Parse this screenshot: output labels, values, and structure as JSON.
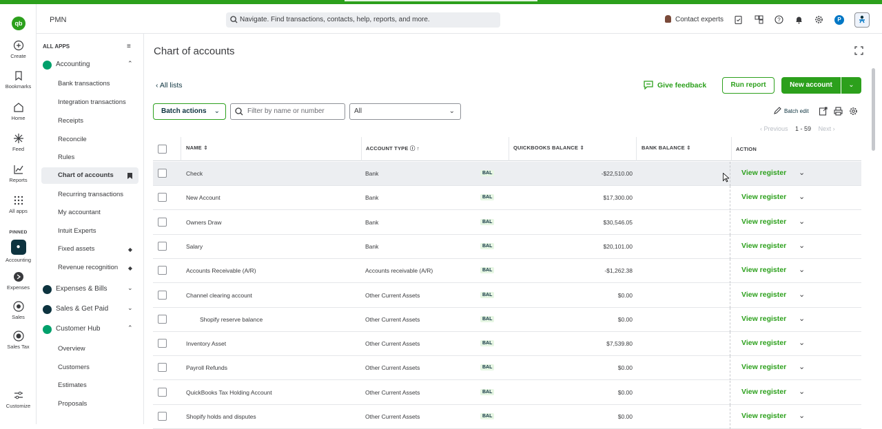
{
  "company": "PMN",
  "search": {
    "placeholder": "Navigate. Find transactions, contacts, help, reports, and more."
  },
  "header": {
    "contact_experts": "Contact experts",
    "avatar_letter": "P"
  },
  "rail": {
    "create": "Create",
    "bookmarks": "Bookmarks",
    "home": "Home",
    "feed": "Feed",
    "reports": "Reports",
    "all_apps": "All apps",
    "pinned": "PINNED",
    "accounting": "Accounting",
    "expenses": "Expenses",
    "sales": "Sales",
    "sales_tax": "Sales Tax",
    "customize": "Customize"
  },
  "sidebar": {
    "all_apps": "ALL APPS",
    "accounting": "Accounting",
    "accounting_items": [
      "Bank transactions",
      "Integration transactions",
      "Receipts",
      "Reconcile",
      "Rules",
      "Chart of accounts",
      "Recurring transactions",
      "My accountant",
      "Intuit Experts",
      "Fixed assets",
      "Revenue recognition"
    ],
    "expenses": "Expenses & Bills",
    "sales": "Sales & Get Paid",
    "customer_hub": "Customer Hub",
    "customer_items": [
      "Overview",
      "Customers",
      "Estimates",
      "Proposals"
    ]
  },
  "main": {
    "title": "Chart of accounts",
    "all_lists": "All lists",
    "give_feedback": "Give feedback",
    "run_report": "Run report",
    "new_account": "New account",
    "batch_actions": "Batch actions",
    "filter_placeholder": "Filter by name or number",
    "type_select": "All",
    "batch_edit": "Batch edit",
    "pager": {
      "previous": "Previous",
      "count": "1 - 59",
      "next": "Next"
    }
  },
  "table": {
    "headers": {
      "name": "NAME",
      "type": "ACCOUNT TYPE",
      "qb_balance": "QUICKBOOKS BALANCE",
      "bank_balance": "BANK BALANCE",
      "action": "ACTION"
    },
    "rows": [
      {
        "name": "Check",
        "type": "Bank",
        "badge": "BAL",
        "qb": "-$22,510.00",
        "bank": "",
        "action": "View register"
      },
      {
        "name": "New Account",
        "type": "Bank",
        "badge": "BAL",
        "qb": "$17,300.00",
        "bank": "",
        "action": "View register"
      },
      {
        "name": "Owners Draw",
        "type": "Bank",
        "badge": "BAL",
        "qb": "$30,546.05",
        "bank": "",
        "action": "View register"
      },
      {
        "name": "Salary",
        "type": "Bank",
        "badge": "BAL",
        "qb": "$20,101.00",
        "bank": "",
        "action": "View register"
      },
      {
        "name": "Accounts Receivable (A/R)",
        "type": "Accounts receivable (A/R)",
        "badge": "BAL",
        "qb": "-$1,262.38",
        "bank": "",
        "action": "View register"
      },
      {
        "name": "Channel clearing account",
        "type": "Other Current Assets",
        "badge": "BAL",
        "qb": "$0.00",
        "bank": "",
        "action": "View register"
      },
      {
        "name": "Shopify reserve balance",
        "type": "Other Current Assets",
        "badge": "BAL",
        "qb": "$0.00",
        "bank": "",
        "action": "View register",
        "sub": true
      },
      {
        "name": "Inventory Asset",
        "type": "Other Current Assets",
        "badge": "BAL",
        "qb": "$7,539.80",
        "bank": "",
        "action": "View register"
      },
      {
        "name": "Payroll Refunds",
        "type": "Other Current Assets",
        "badge": "BAL",
        "qb": "$0.00",
        "bank": "",
        "action": "View register"
      },
      {
        "name": "QuickBooks Tax Holding Account",
        "type": "Other Current Assets",
        "badge": "BAL",
        "qb": "$0.00",
        "bank": "",
        "action": "View register"
      },
      {
        "name": "Shopify holds and disputes",
        "type": "Other Current Assets",
        "badge": "BAL",
        "qb": "$0.00",
        "bank": "",
        "action": "View register"
      }
    ]
  },
  "colors": {
    "brand_green": "#2ca01c",
    "dark_teal": "#0d333f",
    "row_hover": "#eceef1"
  }
}
